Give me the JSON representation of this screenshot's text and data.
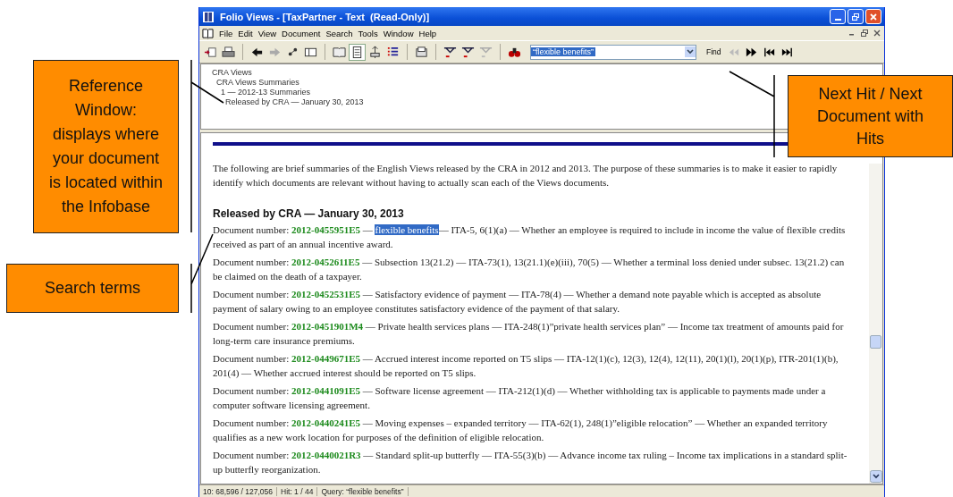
{
  "window": {
    "title": "Folio Views - [TaxPartner - Text  (Read-Only)]"
  },
  "menu": [
    {
      "label": "File"
    },
    {
      "label": "Edit"
    },
    {
      "label": "View"
    },
    {
      "label": "Document"
    },
    {
      "label": "Search"
    },
    {
      "label": "Tools"
    },
    {
      "label": "Window"
    },
    {
      "label": "Help"
    }
  ],
  "toolbar": {
    "query": "“flexible benefits”",
    "find_label": "Find"
  },
  "reference_window": {
    "items": [
      {
        "text": "CRA Views",
        "children": [
          {
            "text": "CRA Views Summaries",
            "children": [
              {
                "text": "1 — 2012-13 Summaries",
                "children": [
                  {
                    "text": "Released by CRA — January 30, 2013"
                  }
                ]
              }
            ]
          }
        ]
      }
    ]
  },
  "document": {
    "intro": "The following are brief summaries of the English Views released by the CRA in 2012 and 2013. The purpose of these summaries is to make it easier to rapidly identify which documents are relevant without having to actually scan each of the Views documents.",
    "heading": "Released by CRA — January 30, 2013",
    "entries": [
      {
        "label": "Document number:",
        "number": "2012-0455951E5",
        "before": "—",
        "hit": "flexible benefits",
        "text": "— ITA-5, 6(1)(a) — Whether an employee is required to include in income the value of flexible credits received as part of an annual incentive award."
      },
      {
        "label": "Document number:",
        "number": "2012-0452611E5",
        "text": "— Subsection 13(21.2) — ITA-73(1), 13(21.1)(e)(iii), 70(5) — Whether a terminal loss denied under subsec. 13(21.2) can be claimed on the death of a taxpayer."
      },
      {
        "label": "Document number:",
        "number": "2012-0452531E5",
        "text": "— Satisfactory evidence of payment — ITA-78(4) — Whether a demand note payable which is accepted as absolute payment of salary owing to an employee constitutes satisfactory evidence of the payment of that salary."
      },
      {
        "label": "Document number:",
        "number": "2012-0451901M4",
        "text": "— Private health services plans — ITA-248(1)”private health services plan” — Income tax treatment of amounts paid for long-term care insurance premiums."
      },
      {
        "label": "Document number:",
        "number": "2012-0449671E5",
        "text": "— Accrued interest income reported on T5 slips — ITA-12(1)(c), 12(3), 12(4), 12(11), 20(1)(l), 20(1)(p), ITR-201(1)(b), 201(4) — Whether accrued interest should be reported on T5 slips."
      },
      {
        "label": "Document number:",
        "number": "2012-0441091E5",
        "text": "— Software license agreement — ITA-212(1)(d) — Whether withholding tax is applicable to payments made under a computer software licensing agreement."
      },
      {
        "label": "Document number:",
        "number": "2012-0440241E5",
        "text": "— Moving expenses – expanded territory — ITA-62(1), 248(1)”eligible relocation” — Whether an expanded territory qualifies as a new work location for purposes of the definition of eligible relocation."
      },
      {
        "label": "Document number:",
        "number": "2012-0440021R3",
        "text": "— Standard split-up butterfly — ITA-55(3)(b) — Advance income tax ruling – Income tax implications in a standard split-up butterfly reorganization."
      }
    ]
  },
  "status_bar": [
    "10: 68,596 / 127,056",
    "Hit: 1 / 44",
    "Query: “flexible benefits”"
  ],
  "annotations": [
    {
      "text": "Reference Window: displays where your document is located within the Infobase"
    },
    {
      "text": "Search terms"
    },
    {
      "text": "Next Hit / Next Document with Hits"
    }
  ]
}
